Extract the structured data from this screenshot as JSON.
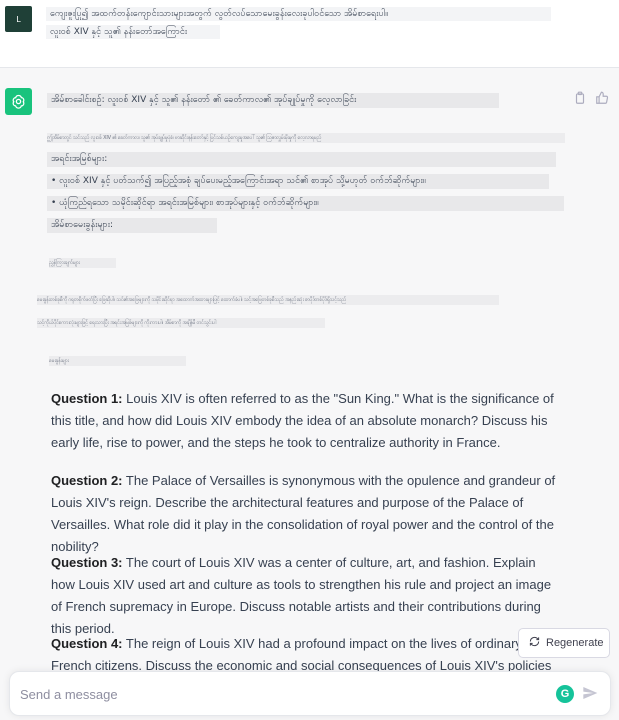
{
  "user_message": {
    "avatar_letter": "L",
    "line1": "ကျေးဇူးပြု၍ အထက်တန်းကျောင်းသားများအတွက် လွတ်လပ်သောမေးခွန်းလေးခုပါဝင်သော အိမ်စာရေးပါ။",
    "line2": "လူးဝစ် XIV နှင့် သူ၏ နန်းတော်အကြောင်း"
  },
  "assistant_message": {
    "intro": "အိမ်စာခေါင်းစဉ်: လူးဝစ် XIV နှင့် သူ၏ နန်းတော် ၏ ခေတ်ကာလ၏ အုပ်ချုပ်မှုကို လေ့လာခြင်း",
    "faint1": "ဤအိမ်စာတွင် သင်သည် လူးဝစ် XIV ၏ ခေတ်ကာလ၊ သူ၏ အုပ်ချုပ်မှုပုံစံ၊ ဗာဆိုင်းနန်းတော်နှင့် ပြင်သစ်ယဉ်ကျေးမှုအပေါ် သူ၏ သြဇာလွှမ်းမိုးမှုကို လေ့လာရမည်",
    "req_title": "အရင်းအမြစ်များ:",
    "req_line1": "• လူးဝစ် XIV နှင့် ပတ်သက်၍ အပြည့်အစုံ ချပ်ပေးမည့်အကြောင်းအရာ သင်၏ စာအုပ် သို့မဟုတ် ဝက်ဘ်ဆိုက်များ။",
    "req_line2": "• ယုံကြည်ရသော သမိုင်းဆိုင်ရာ အရင်းအမြစ်များ၊ စာအုပ်များနှင့် ဝက်ဘ်ဆိုက်များ။",
    "req_line3": "အိမ်စာမေးခွန်းများ:",
    "faint2": "ညွှန်ကြားချက်များ",
    "faint3": "မေးခွန်းတစ်ခုစီကို ဂရုတစိုက်ဖတ်ပြီး ဖြေဆိုပါ။ သင်၏အဖြေများကို သမိုင်းဆိုင်ရာ အထောက်အထားများဖြင့် ထောက်ခံပါ။ သင့်အဖြေတစ်ခုစီသည် အနည်းဆုံး စာပိုဒ်တစ်ပိုဒ်ရှိသင့်သည်",
    "faint4": "သင့်ကိုယ်ပိုင်စကားလုံးများဖြင့် ရေးသားပြီး အရင်းအမြစ်များကို ကိုးကားပါ။ အိမ်စာကို အချိန်မီ တင်သွင်းပါ",
    "faint5": "မေးခွန်းများ",
    "questions": [
      {
        "label": "Question 1:",
        "text": "Louis XIV is often referred to as the \"Sun King.\" What is the significance of this title, and how did Louis XIV embody the idea of an absolute monarch? Discuss his early life, rise to power, and the steps he took to centralize authority in France."
      },
      {
        "label": "Question 2:",
        "text": "The Palace of Versailles is synonymous with the opulence and grandeur of Louis XIV's reign. Describe the architectural features and purpose of the Palace of Versailles. What role did it play in the consolidation of royal power and the control of the nobility?"
      },
      {
        "label": "Question 3:",
        "text": "The court of Louis XIV was a center of culture, art, and fashion. Explain how Louis XIV used art and culture as tools to strengthen his rule and project an image of French supremacy in Europe. Discuss notable artists and their contributions during this period."
      },
      {
        "label": "Question 4:",
        "text": "The reign of Louis XIV had a profound impact on the lives of ordinary French citizens. Discuss the economic and social consequences of Louis XIV's policies and wars on"
      }
    ]
  },
  "regenerate_label": "Regenerate",
  "input": {
    "placeholder": "Send a message"
  },
  "colors": {
    "accent": "#19c37d",
    "user_avatar": "#1f4037",
    "assistant_bg": "#f7f7f8",
    "grammarly": "#15c39a"
  },
  "icons": [
    "openai-logo-icon",
    "copy-icon",
    "thumbs-up-icon",
    "refresh-icon",
    "grammarly-icon",
    "send-icon"
  ]
}
